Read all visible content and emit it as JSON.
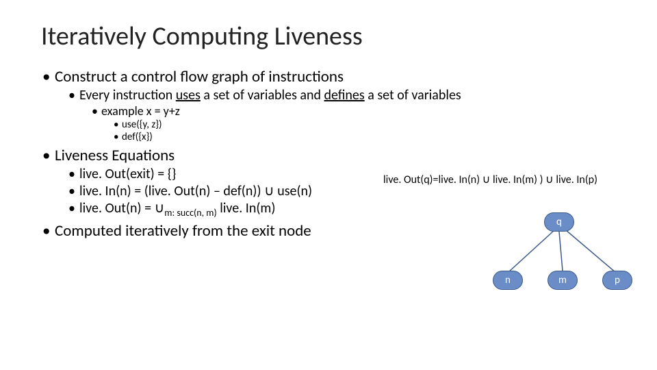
{
  "title": "Iteratively Computing Liveness",
  "b1": "Construct a control flow graph of instructions",
  "b1a_pre": "Every instruction ",
  "b1a_uses": "uses",
  "b1a_mid": " a set of variables and ",
  "b1a_defines": "defines",
  "b1a_post": " a set of variables",
  "b1a_ex": "example  x = y+z",
  "b1a_use": "use({y, z})",
  "b1a_def": "def({x})",
  "b2": "Liveness Equations",
  "b2a": "live. Out(exit) = {}",
  "b2b": "live. In(n) = (live. Out(n) – def(n)) ∪ use(n)",
  "b2c_pre": "live. Out(n) = ∪",
  "b2c_sub": "m: succ(n, m)",
  "b2c_post": " live. In(m)",
  "b3": "Computed iteratively from the exit  node",
  "eqn": "live. Out(q)=live. In(n) ∪ live. In(m) ) ∪ live. In(p)",
  "nodes": {
    "q": "q",
    "n": "n",
    "m": "m",
    "p": "p"
  }
}
